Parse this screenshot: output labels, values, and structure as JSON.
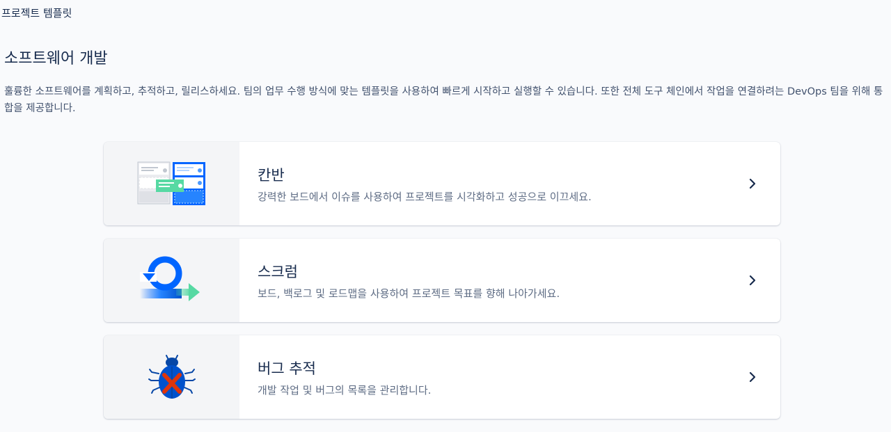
{
  "header": {
    "breadcrumb": "프로젝트 템플릿"
  },
  "section": {
    "title": "소프트웨어 개발",
    "description": "훌륭한 소프트웨어를 계획하고, 추적하고, 릴리스하세요. 팀의 업무 수행 방식에 맞는 템플릿을 사용하여 빠르게 시작하고 실행할 수 있습니다. 또한 전체 도구 체인에서 작업을 연결하려는 DevOps 팀을 위해 통합을 제공합니다."
  },
  "templates": [
    {
      "title": "칸반",
      "description": "강력한 보드에서 이슈를 사용하여 프로젝트를 시각화하고 성공으로 이끄세요.",
      "icon": "kanban-board-icon"
    },
    {
      "title": "스크럼",
      "description": "보드, 백로그 및 로드맵을 사용하여 프로젝트 목표를 향해 나아가세요.",
      "icon": "scrum-cycle-icon"
    },
    {
      "title": "버그 추적",
      "description": "개발 작업 및 버그의 목록을 관리합니다.",
      "icon": "bug-icon"
    }
  ],
  "colors": {
    "blue": "#0065ff",
    "green": "#57d9a3",
    "red": "#de350b",
    "text": "#172b4d",
    "subtext": "#5e6c84"
  }
}
